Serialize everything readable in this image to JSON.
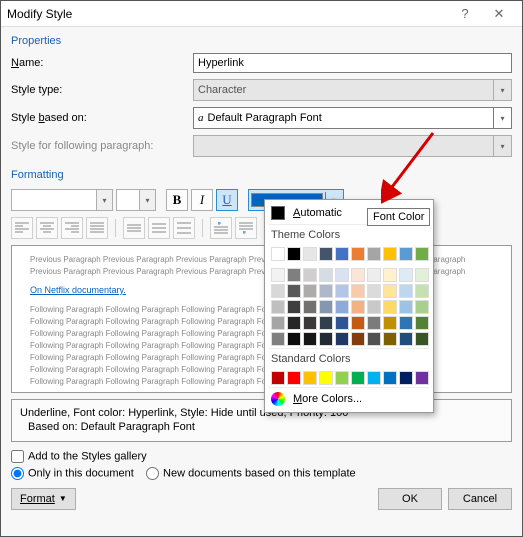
{
  "window": {
    "title": "Modify Style"
  },
  "properties": {
    "header": "Properties",
    "name_label": "Name:",
    "name_value": "Hyperlink",
    "style_type_label": "Style type:",
    "style_type_value": "Character",
    "based_on_label": "Style based on:",
    "based_on_value": "Default Paragraph Font",
    "following_label": "Style for following paragraph:",
    "following_value": ""
  },
  "formatting": {
    "header": "Formatting",
    "bold": "B",
    "italic": "I",
    "underline": "U"
  },
  "preview": {
    "prev": "Previous Paragraph Previous Paragraph Previous Paragraph Previous Paragraph Previous Paragraph Previous Paragraph",
    "sample": "On Netflix documentary.",
    "next": "Following Paragraph Following Paragraph Following Paragraph Following Paragraph Following Paragraph"
  },
  "description": {
    "line1": "Underline, Font color: Hyperlink, Style: Hide until used, Priority: 100",
    "line2": "Based on: Default Paragraph Font"
  },
  "options": {
    "add_gallery": "Add to the Styles gallery",
    "only_doc": "Only in this document",
    "new_docs": "New documents based on this template"
  },
  "buttons": {
    "format": "Format",
    "ok": "OK",
    "cancel": "Cancel"
  },
  "color_popup": {
    "automatic": "Automatic",
    "theme_header": "Theme Colors",
    "standard_header": "Standard Colors",
    "more": "More Colors...",
    "tooltip": "Font Color",
    "theme_row1": [
      "#ffffff",
      "#000000",
      "#e7e6e6",
      "#44546a",
      "#4472c4",
      "#ed7d31",
      "#a5a5a5",
      "#ffc000",
      "#5b9bd5",
      "#70ad47"
    ],
    "theme_shades": [
      [
        "#f2f2f2",
        "#7f7f7f",
        "#d0cece",
        "#d6dce4",
        "#d9e2f3",
        "#fbe5d5",
        "#ededed",
        "#fff2cc",
        "#deebf6",
        "#e2efd9"
      ],
      [
        "#d8d8d8",
        "#595959",
        "#aeabab",
        "#adb9ca",
        "#b4c6e7",
        "#f7cbac",
        "#dbdbdb",
        "#fee599",
        "#bdd7ee",
        "#c5e0b3"
      ],
      [
        "#bfbfbf",
        "#3f3f3f",
        "#757070",
        "#8496b0",
        "#8eaadb",
        "#f4b183",
        "#c9c9c9",
        "#ffd965",
        "#9cc3e5",
        "#a8d08d"
      ],
      [
        "#a5a5a5",
        "#262626",
        "#3a3838",
        "#323f4f",
        "#2f5496",
        "#c55a11",
        "#7b7b7b",
        "#bf9000",
        "#2e75b5",
        "#538135"
      ],
      [
        "#7f7f7f",
        "#0c0c0c",
        "#171616",
        "#222a35",
        "#1f3864",
        "#833c0b",
        "#525252",
        "#7f6000",
        "#1e4e79",
        "#375623"
      ]
    ],
    "standard": [
      "#c00000",
      "#ff0000",
      "#ffc000",
      "#ffff00",
      "#92d050",
      "#00b050",
      "#00b0f0",
      "#0070c0",
      "#002060",
      "#7030a0"
    ]
  }
}
